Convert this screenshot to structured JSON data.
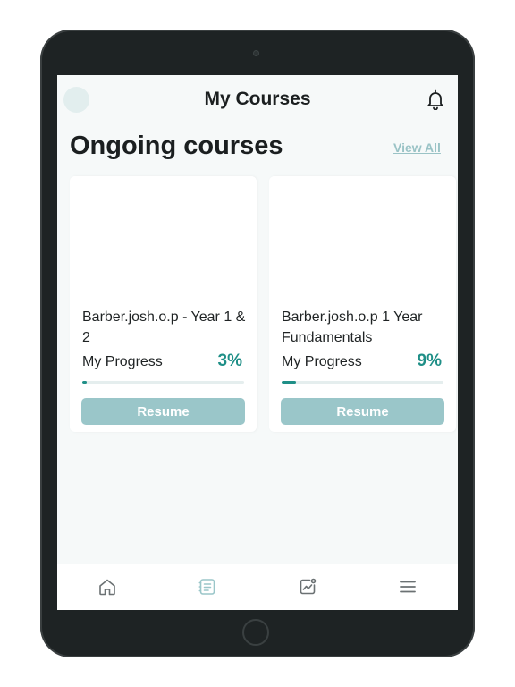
{
  "header": {
    "title": "My Courses",
    "icons": {
      "avatar": "avatar-placeholder",
      "notifications": "bell-icon"
    }
  },
  "section": {
    "title": "Ongoing courses",
    "view_all_label": "View All"
  },
  "courses": [
    {
      "title": "Barber.josh.o.p - Year 1 & 2",
      "progress_label": "My Progress",
      "progress_text": "3%",
      "progress_value": 0.03,
      "resume_label": "Resume"
    },
    {
      "title": "Barber.josh.o.p 1 Year Fundamentals",
      "progress_label": "My Progress",
      "progress_text": "9%",
      "progress_value": 0.09,
      "resume_label": "Resume"
    }
  ],
  "bottom_nav": {
    "items": [
      {
        "icon": "home-icon",
        "active": false
      },
      {
        "icon": "courses-icon",
        "active": true
      },
      {
        "icon": "analytics-icon",
        "active": false
      },
      {
        "icon": "menu-icon",
        "active": false
      }
    ]
  },
  "colors": {
    "accent": "#1f8f87",
    "button": "#9ac6c9",
    "link": "#9ac3c6",
    "nav_active": "#9ac6c9",
    "nav_inactive": "#6b7173"
  }
}
